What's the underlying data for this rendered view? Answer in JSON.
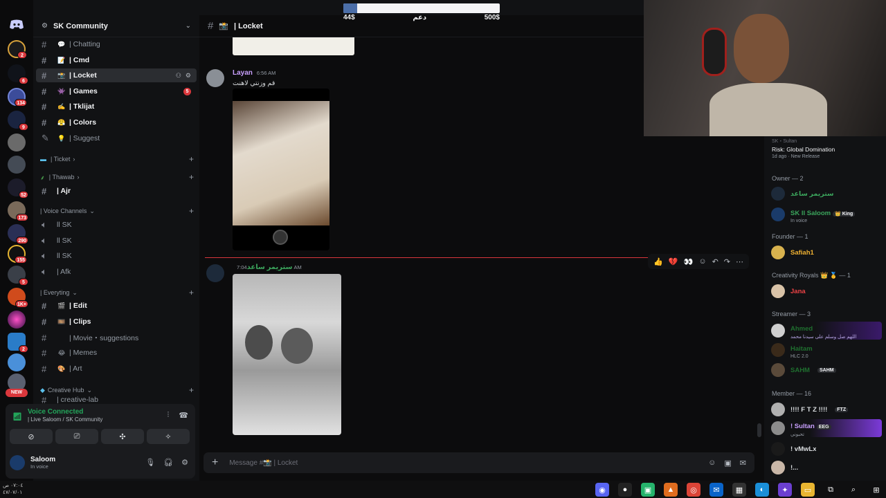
{
  "server": {
    "name": "SK Community"
  },
  "server_rail": {
    "badges": [
      "2",
      "6",
      "134",
      "9",
      "52",
      "173",
      "290",
      "155",
      "5",
      "1K+",
      "2"
    ],
    "new_label": "NEW"
  },
  "channels": [
    {
      "emoji": "💬",
      "label": "| Chatting",
      "style": "muted"
    },
    {
      "emoji": "📝",
      "label": "| Cmd",
      "style": "bright"
    },
    {
      "emoji": "📸",
      "label": "| Locket",
      "style": "active"
    },
    {
      "emoji": "👾",
      "label": "| Games",
      "style": "bright",
      "count": "5"
    },
    {
      "emoji": "✍️",
      "label": "| Tklijat",
      "style": "bright"
    },
    {
      "emoji": "😤",
      "label": "| Colors",
      "style": "bright"
    },
    {
      "emoji": "💡",
      "label": "| Suggest",
      "style": "muted"
    }
  ],
  "categories": {
    "ticket": "| Ticket",
    "thawab": "| Thawab",
    "voice": "| Voice Channels",
    "everyting": "| Everyting",
    "creative": "Creative Hub"
  },
  "thawab_channels": [
    {
      "label": "| Ajr"
    }
  ],
  "voice_channels": [
    {
      "label": "ll SK"
    },
    {
      "label": "ll SK"
    },
    {
      "label": "ll SK"
    },
    {
      "label": "| Afk"
    }
  ],
  "everyting_channels": [
    {
      "emoji": "🎬",
      "label": "| Edit",
      "style": "bright"
    },
    {
      "emoji": "🎞️",
      "label": "| Clips",
      "style": "bright"
    },
    {
      "emoji": "",
      "label": "| Movie・suggestions",
      "style": "muted"
    },
    {
      "emoji": "😂",
      "label": "| Memes",
      "style": "muted"
    },
    {
      "emoji": "🎨",
      "label": "| Art",
      "style": "muted"
    }
  ],
  "creative_partial": "| creative-lab",
  "voice_panel": {
    "status": "Voice Connected",
    "channel": "| Live Saloom / SK Community",
    "user": "Saloom",
    "user_status": "In voice"
  },
  "chat": {
    "channel": "| Locket",
    "placeholder": "Message #📸 | Locket",
    "messages": [
      {
        "author": "Layan",
        "time": "6:56 AM",
        "text": "قم وزنتي لاهنت",
        "color": "#c9a0ff"
      },
      {
        "author": "ستريمر ساعد",
        "time": "7:04 AM",
        "text": "",
        "color": "#3ba55c"
      }
    ],
    "reactions": [
      "👍",
      "💔",
      "👀"
    ]
  },
  "members": {
    "activity": {
      "line1": "SK・Sultan",
      "title": "Risk: Global Domination",
      "meta": "1d ago · New Release"
    },
    "groups": [
      {
        "title": "Owner — 2",
        "people": [
          {
            "name": "ستريمر ساعد",
            "status": "",
            "color": "#3ba55c"
          },
          {
            "name": "SK ll Saloom",
            "tag": "👑 King",
            "status": "In voice",
            "color": "#3ba55c"
          }
        ]
      },
      {
        "title": "Founder — 1",
        "people": [
          {
            "name": "Safiah1",
            "color": "#f0b232"
          }
        ]
      },
      {
        "title": "Creativity Royals 👑 🥇 — 1",
        "people": [
          {
            "name": "Jana",
            "color": "#ed4245"
          }
        ]
      },
      {
        "title": "Streamer — 3",
        "people": [
          {
            "name": "Ahmed",
            "status": "اللهم صل وسلم على سيدنا محمد",
            "color": "#1f6f2f"
          },
          {
            "name": "Haitam",
            "status": "HLC 2.0",
            "color": "#1f6f2f"
          },
          {
            "name": "SAHM",
            "tag": "SAHM",
            "color": "#1f6f2f"
          }
        ]
      },
      {
        "title": "Member — 16",
        "people": [
          {
            "name": "!!!! F T Z !!!!",
            "tag": "FTZ",
            "color": "#dbdee1"
          },
          {
            "name": "! Sultan",
            "tag": "EEG",
            "status": "تحبوني",
            "color": "#c9a0ff"
          },
          {
            "name": "! vMwLx",
            "color": "#dbdee1"
          },
          {
            "name": "!...",
            "color": "#dbdee1"
          }
        ]
      }
    ]
  },
  "donation": {
    "current": "44$",
    "label": "دعم",
    "goal": "500$",
    "progress": 0.088
  },
  "taskbar": {
    "time": "٠٧:٠٤ ص",
    "date": "٤٧/٠٧/٠١"
  },
  "colors": {
    "accent": "#5865f2",
    "online": "#23a55a",
    "danger": "#da373c"
  }
}
